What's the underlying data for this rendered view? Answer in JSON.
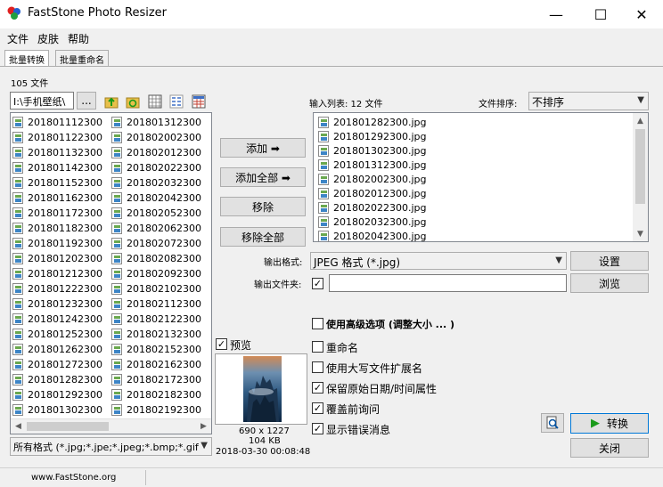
{
  "window": {
    "title": "FastStone Photo Resizer",
    "minimize": "—",
    "maximize": "☐",
    "close": "✕"
  },
  "menu": [
    "文件",
    "皮肤",
    "帮助"
  ],
  "tabs": [
    "批量转换",
    "批量重命名"
  ],
  "left": {
    "folder_count": "105 文件",
    "path": "I:\\手机壁纸\\",
    "browse_label": "...",
    "col1": [
      "201801112300",
      "201801122300",
      "201801132300",
      "201801142300",
      "201801152300",
      "201801162300",
      "201801172300",
      "201801182300",
      "201801192300",
      "201801202300",
      "201801212300",
      "201801222300",
      "201801232300",
      "201801242300",
      "201801252300",
      "201801262300",
      "201801272300",
      "201801282300",
      "201801292300",
      "201801302300"
    ],
    "col2": [
      "201801312300",
      "201802002300",
      "201802012300",
      "201802022300",
      "201802032300",
      "201802042300",
      "201802052300",
      "201802062300",
      "201802072300",
      "201802082300",
      "201802092300",
      "201802102300",
      "201802112300",
      "201802122300",
      "201802132300",
      "201802152300",
      "201802162300",
      "201802172300",
      "201802182300",
      "201802192300"
    ],
    "filter": "所有格式 (*.jpg;*.jpe;*.jpeg;*.bmp;*.gif"
  },
  "middle": {
    "add": "添加 ➡",
    "add_all": "添加全部 ➡",
    "remove": "移除",
    "remove_all": "移除全部",
    "preview_label": "预览",
    "preview_dims": "690 x 1227",
    "preview_size": "104 KB",
    "preview_date": "2018-03-30 00:08:48"
  },
  "right": {
    "input_list_label": "输入列表: 12 文件",
    "sort_label": "文件排序:",
    "sort_value": "不排序",
    "files": [
      "201801282300.jpg",
      "201801292300.jpg",
      "201801302300.jpg",
      "201801312300.jpg",
      "201802002300.jpg",
      "201802012300.jpg",
      "201802022300.jpg",
      "201802032300.jpg",
      "201802042300.jpg"
    ],
    "output_format_label": "输出格式:",
    "output_format_value": "JPEG 格式 (*.jpg)",
    "settings": "设置",
    "output_folder_label": "输出文件夹:",
    "output_folder_value": "",
    "browse": "浏览",
    "options": [
      {
        "label": "使用高级选项 (调整大小 ... )",
        "checked": false
      },
      {
        "label": "重命名",
        "checked": false
      },
      {
        "label": "使用大写文件扩展名",
        "checked": false
      },
      {
        "label": "保留原始日期/时间属性",
        "checked": true
      },
      {
        "label": "覆盖前询问",
        "checked": true
      },
      {
        "label": "显示错误消息",
        "checked": true
      }
    ],
    "convert": "转换",
    "close": "关闭"
  },
  "status": {
    "website": "www.FastStone.org"
  },
  "colors": {
    "accent": "#0078d7",
    "convert_arrow": "#1a9a1a"
  }
}
